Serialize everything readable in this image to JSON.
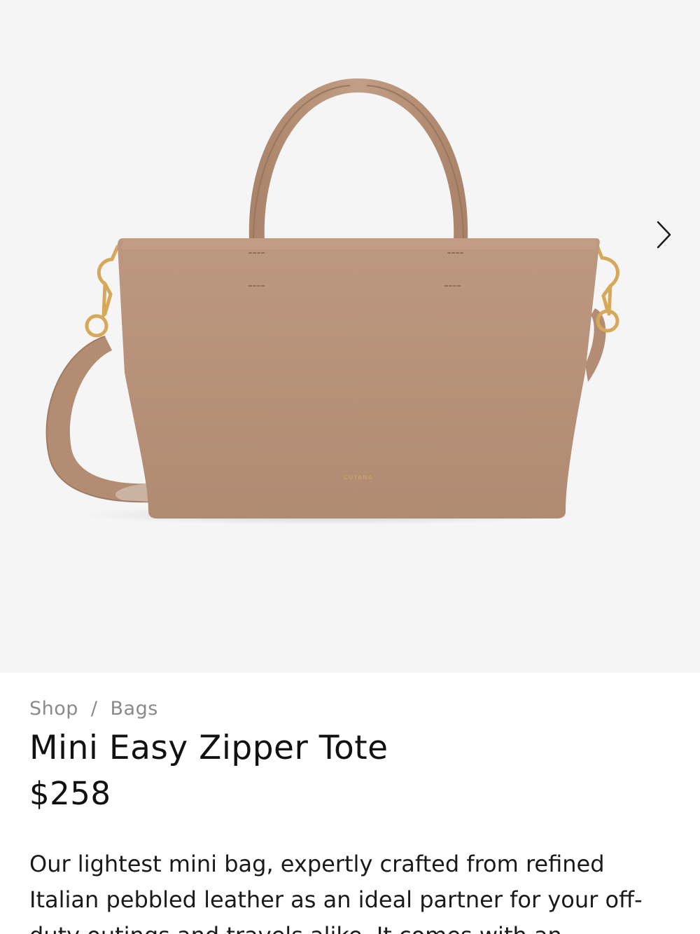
{
  "product": {
    "brand_mark": "CUYANA",
    "colors": {
      "leather": "#b9937a",
      "hardware": "#d6a85a",
      "gallery_background": "#f5f5f6"
    }
  },
  "gallery": {
    "next_icon": "chevron-right-icon"
  },
  "breadcrumb": {
    "items": [
      "Shop",
      "Bags"
    ],
    "separator": "/"
  },
  "title": "Mini Easy Zipper Tote",
  "price": "$258",
  "description": "Our lightest mini bag, expertly crafted from refined Italian pebbled leather as an ideal partner for your off-duty outings and travels alike. It comes with an"
}
